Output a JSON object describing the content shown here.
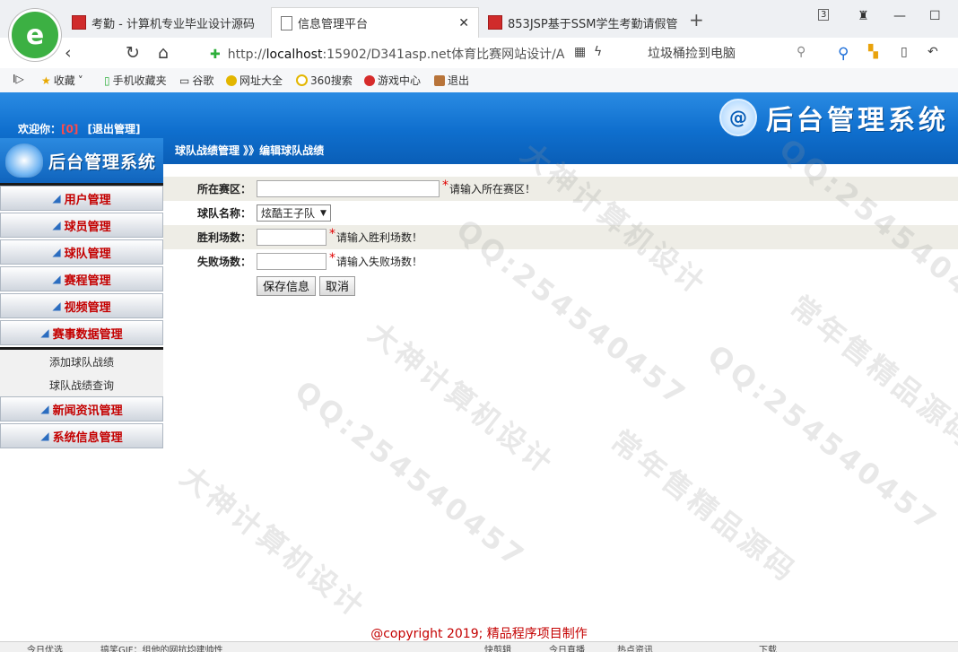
{
  "browser": {
    "tabs": [
      {
        "label": "考勤 - 计算机专业毕业设计源码",
        "icon": "red-app-icon"
      },
      {
        "label": "信息管理平台",
        "icon": "document-icon"
      },
      {
        "label": "853JSP基于SSM学生考勤请假管",
        "icon": "red-app-icon"
      }
    ],
    "tab_count": "3",
    "url_host": "localhost",
    "url_prefix": "http://",
    "url_rest": ":15902/D341asp.net体育比赛网站设计/A",
    "search_hint": "垃圾桶捡到电脑",
    "bookmarks": [
      "收藏",
      "手机收藏夹",
      "谷歌",
      "网址大全",
      "360搜索",
      "游戏中心",
      "退出"
    ]
  },
  "header": {
    "welcome": "欢迎你：",
    "username": "[0]",
    "logout": "[退出管理]",
    "title": "后台管理系统",
    "logo_letter": "@"
  },
  "sidebar": {
    "brand": "后台管理系统",
    "items": [
      {
        "label": "用户管理"
      },
      {
        "label": "球员管理"
      },
      {
        "label": "球队管理"
      },
      {
        "label": "赛程管理"
      },
      {
        "label": "视频管理"
      },
      {
        "label": "赛事数据管理"
      }
    ],
    "subitems": [
      {
        "label": "添加球队战绩"
      },
      {
        "label": "球队战绩查询"
      }
    ],
    "items_after": [
      {
        "label": "新闻资讯管理"
      },
      {
        "label": "系统信息管理"
      }
    ]
  },
  "main": {
    "breadcrumb": "球队战绩管理 》》编辑球队战绩",
    "form": {
      "fields": [
        {
          "label": "所在赛区：",
          "value": "",
          "hint": "请输入所在赛区！"
        },
        {
          "label": "球队名称：",
          "value": "炫酷王子队"
        },
        {
          "label": "胜利场数：",
          "value": "",
          "hint": "请输入胜利场数！"
        },
        {
          "label": "失败场数：",
          "value": "",
          "hint": "请输入失败场数！"
        }
      ],
      "save_label": "保存信息",
      "cancel_label": "取消"
    }
  },
  "footer": {
    "copyright": "@copyright 2019; 精品程序项目制作"
  },
  "statusbar": {
    "left": "今日优选",
    "news": "搞笑GIF：组他的网抗均建帅性",
    "quick": "快剪辑",
    "live": "今日直播",
    "hot": "热点资讯",
    "download": "下载"
  },
  "watermarks": [
    "大神计算机设计",
    "QQ:254540457",
    "常年售精品源码"
  ],
  "colors": {
    "accent": "#0f6fce",
    "menu_text": "#c40000",
    "required": "#e00000"
  }
}
